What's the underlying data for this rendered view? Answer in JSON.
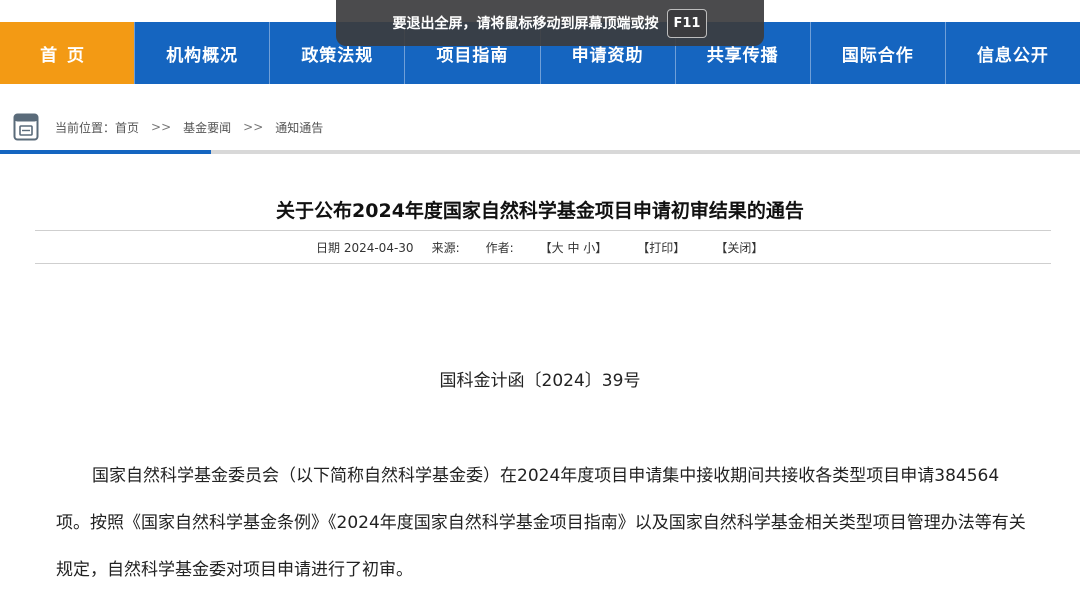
{
  "toast": {
    "message": "要退出全屏，请将鼠标移动到屏幕顶端或按",
    "key": "F11"
  },
  "nav": {
    "items": [
      {
        "label": "首页",
        "active": true
      },
      {
        "label": "机构概况"
      },
      {
        "label": "政策法规"
      },
      {
        "label": "项目指南"
      },
      {
        "label": "申请资助"
      },
      {
        "label": "共享传播"
      },
      {
        "label": "国际合作"
      },
      {
        "label": "信息公开"
      }
    ]
  },
  "breadcrumb": {
    "prefix": "当前位置：",
    "home": "首页",
    "separator": ">>",
    "level1": "基金要闻",
    "level2": "通知通告",
    "icon": "document-icon"
  },
  "article": {
    "title": "关于公布2024年度国家自然科学基金项目申请初审结果的通告",
    "meta": {
      "date": "日期 2024-04-30",
      "source": "来源:",
      "author": "作者:",
      "font_size": "【大 中 小】",
      "print": "【打印】",
      "close": "【关闭】"
    },
    "doc_number": "国科金计函〔2024〕39号",
    "paragraph1": "国家自然科学基金委员会（以下简称自然科学基金委）在2024年度项目申请集中接收期间共接收各类型项目申请384564项。按照《国家自然科学基金条例》《2024年度国家自然科学基金项目指南》以及国家自然科学基金相关类型项目管理办法等有关规定，自然科学基金委对项目申请进行了初审。"
  },
  "colors": {
    "nav_blue": "#1565c0",
    "nav_active": "#f39a14"
  }
}
